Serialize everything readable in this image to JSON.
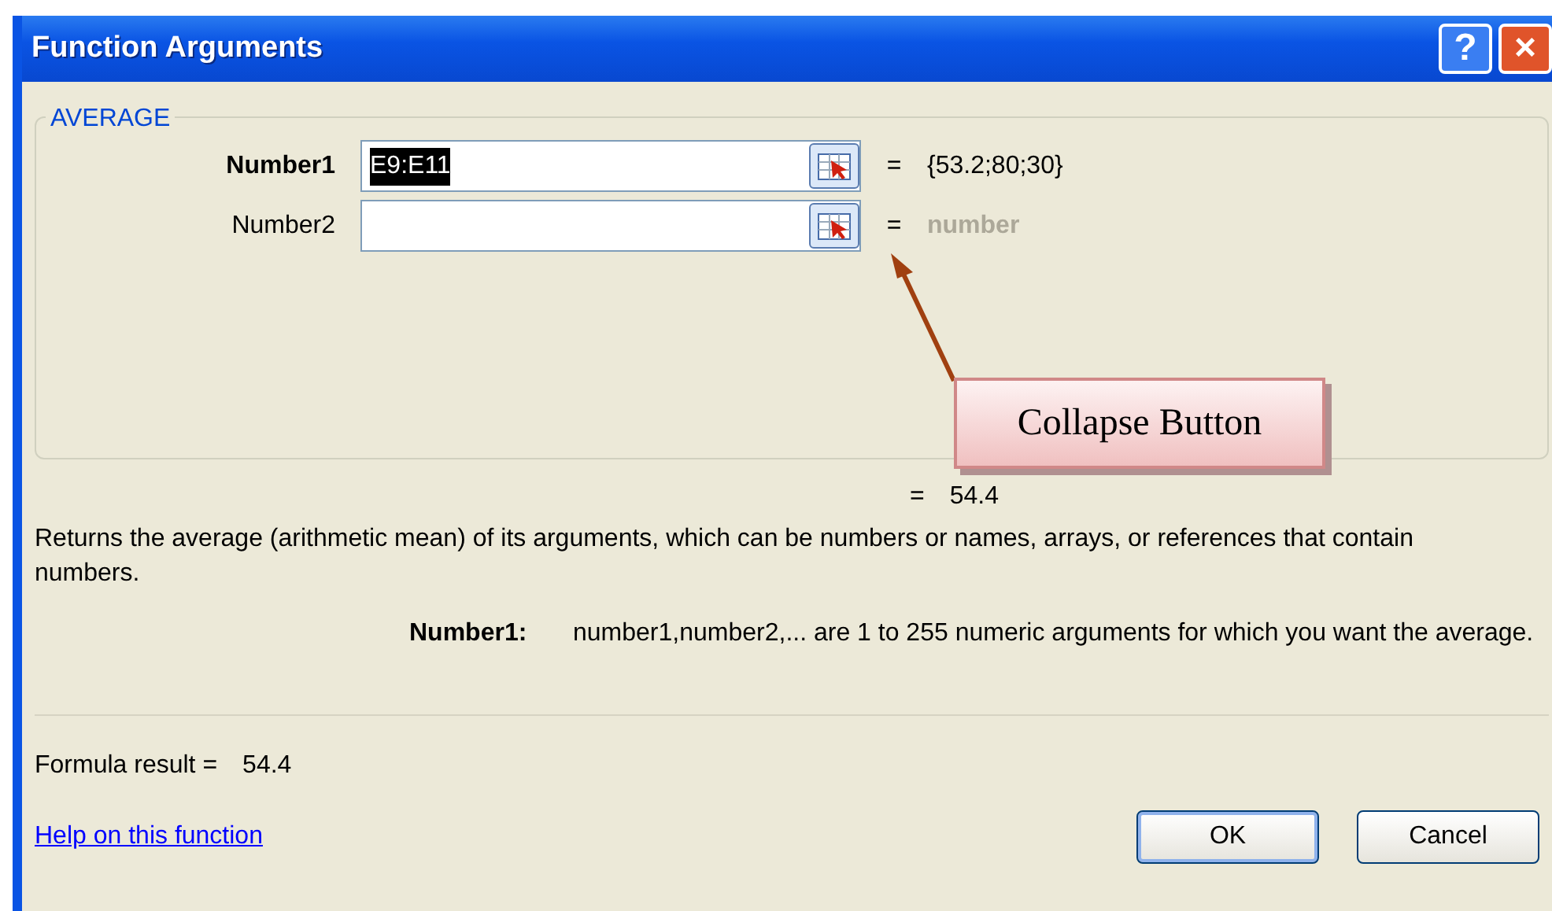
{
  "window": {
    "title": "Function Arguments",
    "buttons": [
      {
        "kind": "help",
        "label": "?"
      },
      {
        "kind": "close",
        "label": "×"
      }
    ]
  },
  "function_group": {
    "title": "AVERAGE",
    "arguments": [
      {
        "label": "Number1",
        "selected": true,
        "value": "E9:E11",
        "value_selected": true,
        "equals": "=",
        "result": "{53.2;80;30}",
        "greyed": false
      },
      {
        "label": "Number2",
        "selected": false,
        "equals": "=",
        "result": "number",
        "greyed": true
      }
    ]
  },
  "callout": {
    "text": "Collapse Button"
  },
  "result_line": {
    "equals": "=",
    "value": "54.4"
  },
  "description": "Returns the average (arithmetic mean) of its arguments, which can be numbers or names, arrays, or references that contain numbers.",
  "argument_help": {
    "label": "Number1:",
    "text": "number1,number2,... are 1 to 255 numeric arguments for which you want the average."
  },
  "formula_result": {
    "label": "Formula result =",
    "value": "54.4"
  },
  "help_link": "Help on this function",
  "buttons": [
    {
      "label": "OK",
      "default": true
    },
    {
      "label": "Cancel",
      "default": false
    }
  ]
}
